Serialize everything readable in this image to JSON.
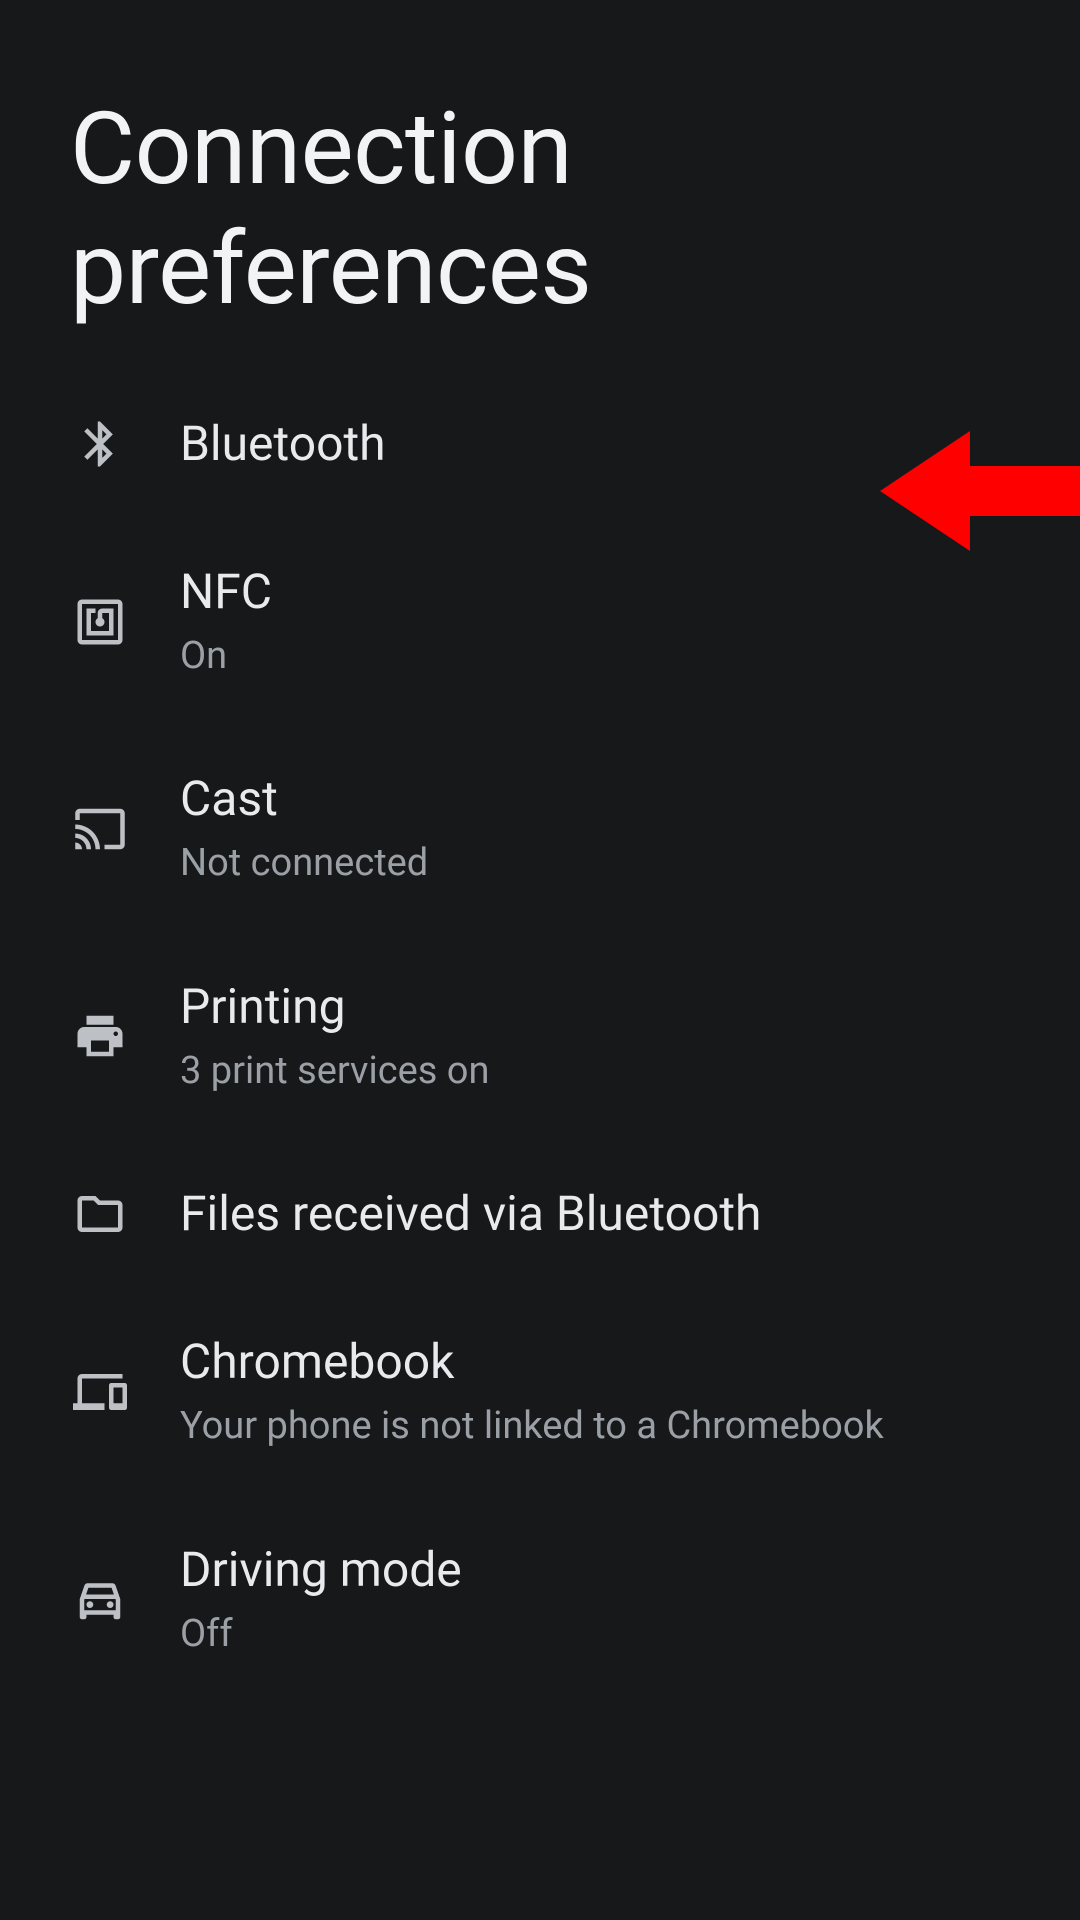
{
  "header": {
    "title": "Connection preferences"
  },
  "items": [
    {
      "title": "Bluetooth"
    },
    {
      "title": "NFC",
      "subtitle": "On"
    },
    {
      "title": "Cast",
      "subtitle": "Not connected"
    },
    {
      "title": "Printing",
      "subtitle": "3 print services on"
    },
    {
      "title": "Files received via Bluetooth"
    },
    {
      "title": "Chromebook",
      "subtitle": "Your phone is not linked to a Chromebook"
    },
    {
      "title": "Driving mode",
      "subtitle": "Off"
    }
  ]
}
